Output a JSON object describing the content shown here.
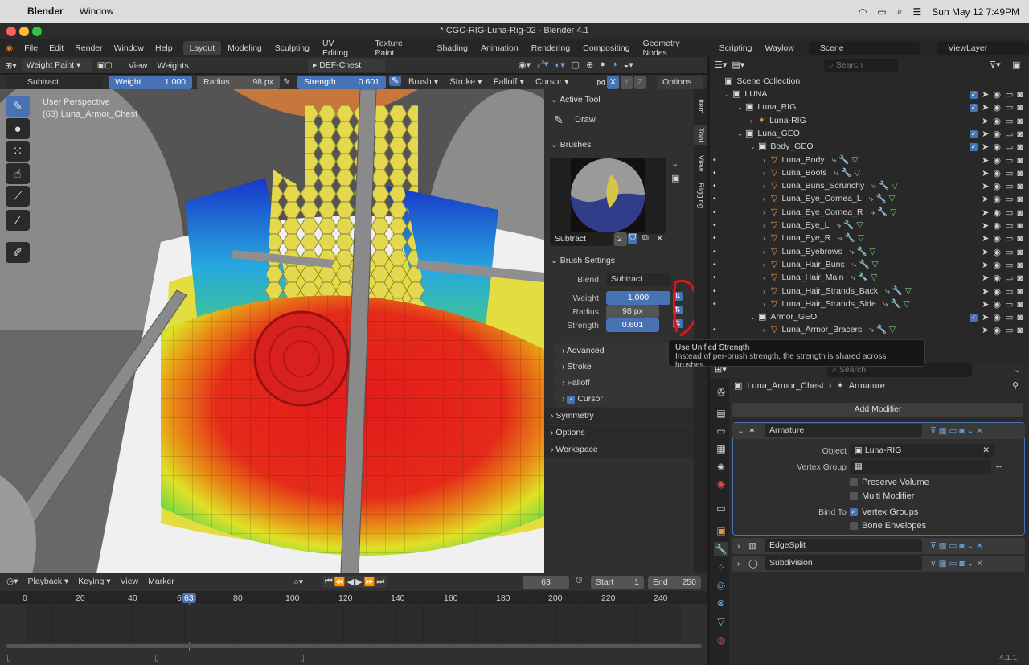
{
  "mac": {
    "menu": [
      "Blender",
      "Window"
    ],
    "datetime": "Sun May 12  7:49PM"
  },
  "window_title": "* CGC-RIG-Luna-Rig-02 - Blender 4.1",
  "menu": [
    "File",
    "Edit",
    "Render",
    "Window",
    "Help"
  ],
  "workspaces": [
    "Layout",
    "Modeling",
    "Sculpting",
    "UV Editing",
    "Texture Paint",
    "Shading",
    "Animation",
    "Rendering",
    "Compositing",
    "Geometry Nodes",
    "Scripting",
    "Waylow"
  ],
  "scene": "Scene",
  "viewlayer": "ViewLayer",
  "header": {
    "mode": "Weight Paint",
    "view": "View",
    "weights": "Weights",
    "vertex_group": "DEF-Chest"
  },
  "toolsettings": {
    "brush_name": "Subtract",
    "weight_label": "Weight",
    "weight": "1.000",
    "radius_label": "Radius",
    "radius": "98 px",
    "strength_label": "Strength",
    "strength": "0.601",
    "brush": "Brush",
    "stroke": "Stroke",
    "falloff": "Falloff",
    "cursor": "Cursor",
    "options": "Options",
    "axes": [
      "X",
      "Y",
      "Z"
    ]
  },
  "viewport": {
    "perspective": "User Perspective",
    "object": "(63) Luna_Armor_Chest"
  },
  "npanel": {
    "active_tool": "Active Tool",
    "draw": "Draw",
    "brushes": "Brushes",
    "brush_name": "Subtract",
    "brush_users": "2",
    "brush_settings": "Brush Settings",
    "blend_label": "Blend",
    "blend": "Subtract",
    "weight_label": "Weight",
    "weight": "1.000",
    "radius_label": "Radius",
    "radius": "98 px",
    "strength_label": "Strength",
    "strength": "0.601",
    "advanced": "Advanced",
    "stroke": "Stroke",
    "falloff": "Falloff",
    "cursor": "Cursor",
    "symmetry": "Symmetry",
    "options": "Options",
    "workspace": "Workspace",
    "tabs": [
      "Item",
      "Tool",
      "View",
      "Rigging"
    ]
  },
  "tooltip": {
    "title": "Use Unified Strength",
    "body": "Instead of per-brush strength, the strength is shared across brushes."
  },
  "timeline": {
    "playback": "Playback",
    "keying": "Keying",
    "view": "View",
    "marker": "Marker",
    "frame": "63",
    "start_label": "Start",
    "start": "1",
    "end_label": "End",
    "end": "250",
    "ticks": [
      "0",
      "20",
      "40",
      "6",
      "80",
      "100",
      "120",
      "140",
      "160",
      "180",
      "200",
      "220",
      "240"
    ],
    "current": "63"
  },
  "outliner": {
    "search": "Search",
    "collection": "Scene Collection",
    "rows": [
      "LUNA",
      "Luna_RIG",
      "Luna-RIG",
      "Luna_GEO",
      "Body_GEO",
      "Luna_Body",
      "Luna_Boots",
      "Luna_Buns_Scrunchy",
      "Luna_Eye_Cornea_L",
      "Luna_Eye_Cornea_R",
      "Luna_Eye_L",
      "Luna_Eye_R",
      "Luna_Eyebrows",
      "Luna_Hair_Buns",
      "Luna_Hair_Main",
      "Luna_Hair_Strands_Back",
      "Luna_Hair_Strands_Side",
      "Armor_GEO",
      "Luna_Armor_Bracers"
    ]
  },
  "properties": {
    "search": "Search",
    "object": "Luna_Armor_Chest",
    "modifier_ctx": "Armature",
    "add_modifier": "Add Modifier",
    "mod1": "Armature",
    "object_label": "Object",
    "object_value": "Luna-RIG",
    "vgroup_label": "Vertex Group",
    "preserve": "Preserve Volume",
    "multi": "Multi Modifier",
    "bind_label": "Bind To",
    "vgroups": "Vertex Groups",
    "envelopes": "Bone Envelopes",
    "mod2": "EdgeSplit",
    "mod3": "Subdivision"
  },
  "version": "4.1.1"
}
